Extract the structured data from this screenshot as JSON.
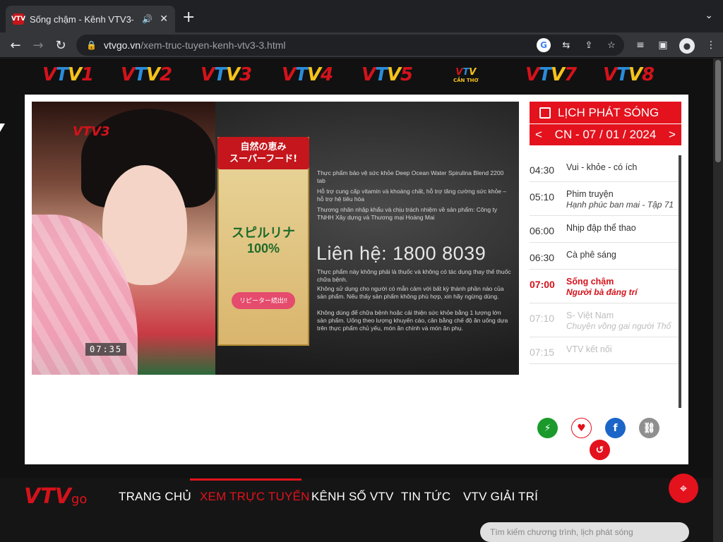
{
  "browser": {
    "tab_title": "Sống chậm - Kênh VTV3-",
    "favicon_label": "VTV",
    "new_tab": "+",
    "url_host": "vtvgo.vn",
    "url_path": "/xem-truc-tuyen-kenh-vtv3-3.html"
  },
  "channels": [
    {
      "letters": "VTV",
      "num": "1"
    },
    {
      "letters": "VTV",
      "num": "2"
    },
    {
      "letters": "VTV",
      "num": "3"
    },
    {
      "letters": "VTV",
      "num": "4"
    },
    {
      "letters": "VTV",
      "num": "5"
    },
    {
      "letters": "VTV",
      "sub": "CẦN THƠ"
    },
    {
      "letters": "VTV",
      "num": "7"
    },
    {
      "letters": "VTV",
      "num": "8"
    }
  ],
  "player": {
    "logo": "VTV3",
    "clock": "07:35",
    "product_jp_line1": "自然の恵み",
    "product_jp_line2": "スーパーフード!",
    "product_name_line1": "スピルリナ",
    "product_name_line2": "100%",
    "product_badge": "リピーター続出!!",
    "ad_block1": "Thực phẩm bảo vệ sức khỏe Deep Ocean Water Spirulina Blend 2200 tab",
    "ad_block2": "Hỗ trợ cung cấp vitamin và khoáng chất, hỗ trợ tăng cường sức khỏe – hỗ trợ hệ tiêu hóa",
    "ad_block3": "Thương nhân nhập khẩu và chịu trách nhiệm về sản phẩm: Công ty TNHH Xây dựng và Thương mại Hoàng Mai",
    "ad_phone": "Liên hệ: 1800 8039",
    "ad_block4": "Thực phẩm này không phải là thuốc và không có tác dụng thay thế thuốc chữa bệnh.",
    "ad_block5": "Không sử dụng cho người có mẫn cảm với bất kỳ thành phần nào của sản phẩm. Nếu thấy sản phẩm không phù hợp, xin hãy ngừng dùng.",
    "ad_block6": "Không dùng để chữa bệnh hoặc cải thiện sức khỏe bằng 1 lượng lớn sản phẩm. Uống theo lượng khuyến cáo, cân bằng chế độ ăn uống dựa trên thực phẩm chủ yếu, món ăn chính và món ăn phụ."
  },
  "schedule": {
    "title": "LỊCH PHÁT SÓNG",
    "prev": "<",
    "next": ">",
    "date": "CN - 07 / 01 / 2024",
    "items": [
      {
        "time": "04:30",
        "title": "Vui - khỏe - có ích",
        "sub": ""
      },
      {
        "time": "05:10",
        "title": "Phim truyện",
        "sub": "Hạnh phúc ban mai - Tập 71"
      },
      {
        "time": "06:00",
        "title": "Nhịp đập thể thao",
        "sub": ""
      },
      {
        "time": "06:30",
        "title": "Cà phê sáng",
        "sub": ""
      },
      {
        "time": "07:00",
        "title": "Sống chậm",
        "sub": "Người bà đảng trí",
        "state": "current"
      },
      {
        "time": "07:10",
        "title": "S- Việt Nam",
        "sub": "Chuyện võng gai người Thổ",
        "state": "future"
      },
      {
        "time": "07:15",
        "title": "VTV kết nối",
        "sub": "",
        "state": "future"
      }
    ]
  },
  "share": {
    "colors": {
      "lightning": "#1a9a2a",
      "heart": "#e3121d",
      "facebook": "#1b65c8",
      "link": "#8f8f8f",
      "replay": "#e3121d"
    }
  },
  "footer": {
    "logo_vtv": "VTV",
    "logo_go": "go",
    "nav": [
      "TRANG CHỦ",
      "XEM TRỰC TUYẾN",
      "KÊNH SỐ VTV",
      "TIN TỨC",
      "VTV GIẢI TRÍ"
    ],
    "active_index": 1,
    "search_placeholder": "Tìm kiếm chương trình, lịch phát sóng"
  }
}
